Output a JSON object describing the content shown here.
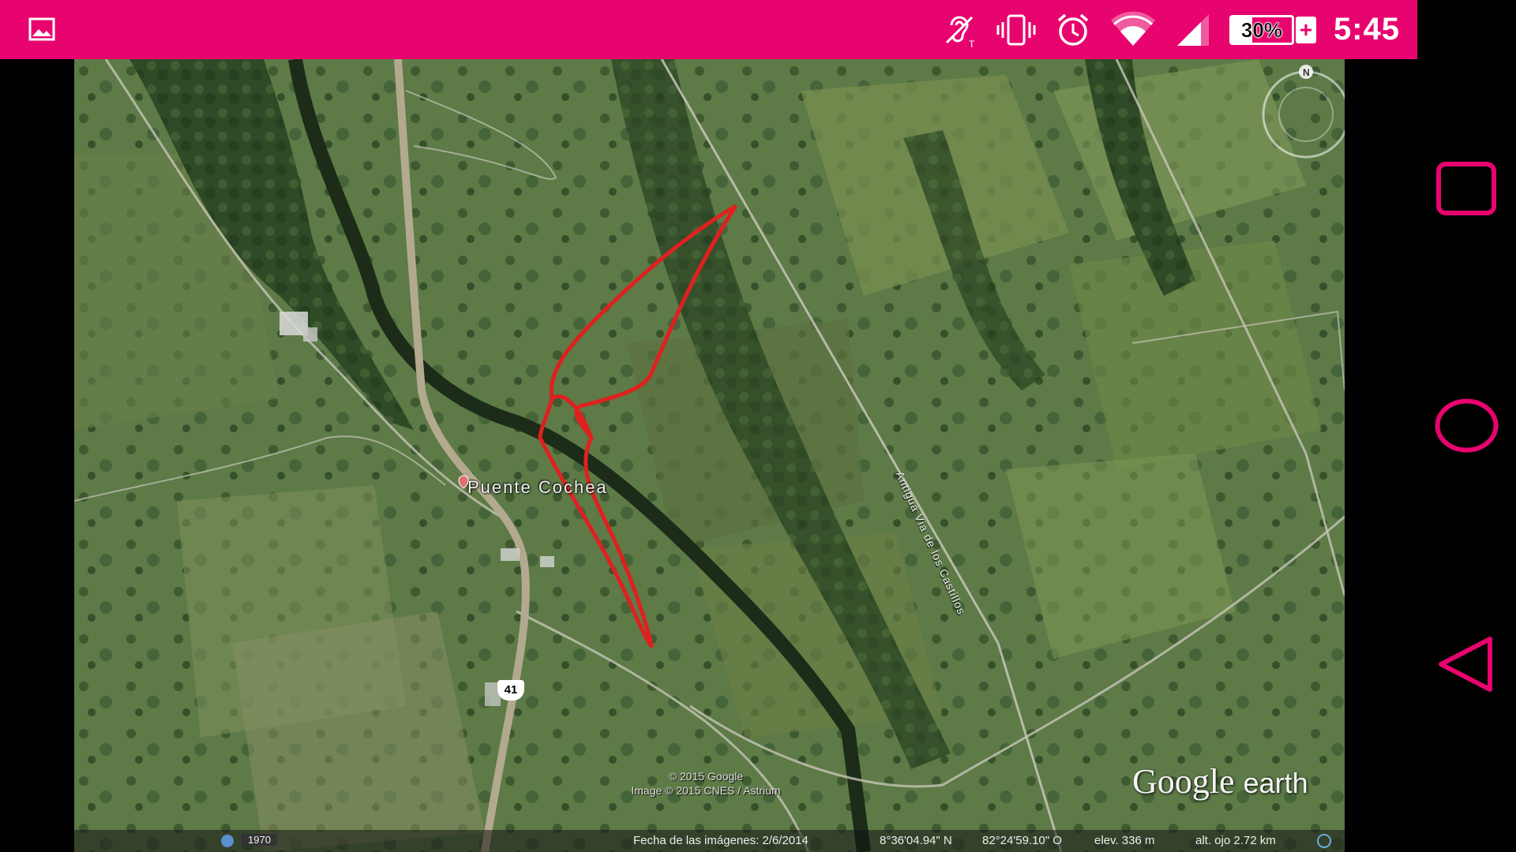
{
  "status_bar": {
    "battery_percent": "30%",
    "charging_symbol": "+",
    "time": "5:45",
    "icons": [
      "gallery-icon",
      "hearing-aid-icon",
      "vibrate-icon",
      "alarm-icon",
      "wifi-icon",
      "cellular-signal-icon",
      "battery-icon"
    ],
    "color": "#e8046e"
  },
  "map": {
    "place_label": "Puente Cochea",
    "road_label": "Antigua Via de los Castillos",
    "route_number": "41",
    "copyright_line1": "© 2015 Google",
    "copyright_line2": "Image © 2015 CNES / Astrium",
    "logo_google": "Google",
    "logo_earth": "earth",
    "year": "1970",
    "imagery_date": "Fecha de las imágenes: 2/6/2014",
    "latitude": "8°36'04.94\" N",
    "longitude": "82°24'59.10\" O",
    "elevation": "elev.  336 m",
    "eye_altitude": "alt. ojo  2.72 km",
    "compass_label": "N",
    "outline_color": "#e02020"
  },
  "nav_bar": {
    "icons": [
      "recents-square-icon",
      "home-circle-icon",
      "back-triangle-icon"
    ],
    "color": "#e8046e"
  }
}
